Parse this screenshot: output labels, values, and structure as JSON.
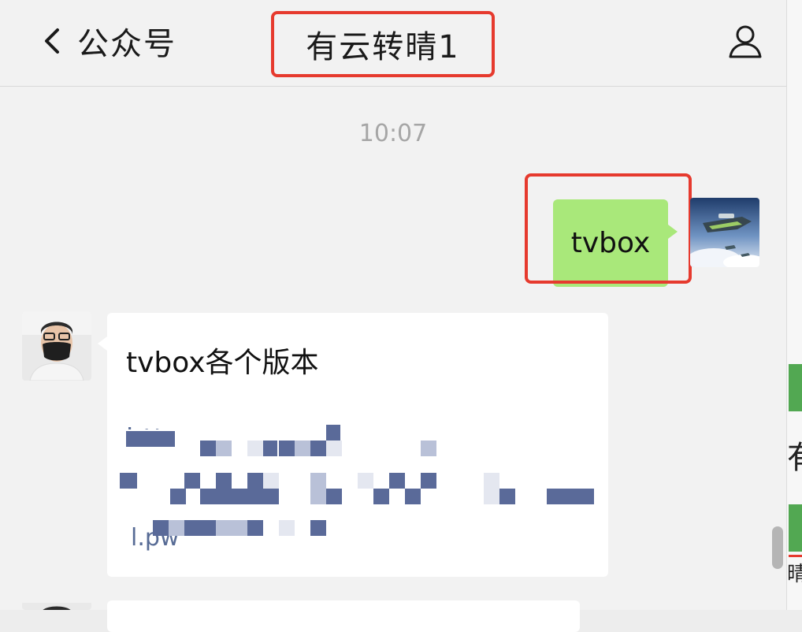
{
  "header": {
    "back_label": "公众号",
    "title": "有云转晴1"
  },
  "timestamp": "10:07",
  "messages": {
    "sent": {
      "text": "tvbox"
    },
    "received": {
      "title": "tvbox各个版本",
      "link_fragment_top": "htt",
      "link_fragment_bottom": "l.pw"
    }
  },
  "right_strip": {
    "chars": [
      "有",
      "晴"
    ]
  },
  "colors": {
    "highlight": "#e63a2e",
    "sent_bubble": "#a9e87a",
    "link": "#576b95"
  },
  "icons": [
    "chevron-left-icon",
    "person-icon"
  ]
}
